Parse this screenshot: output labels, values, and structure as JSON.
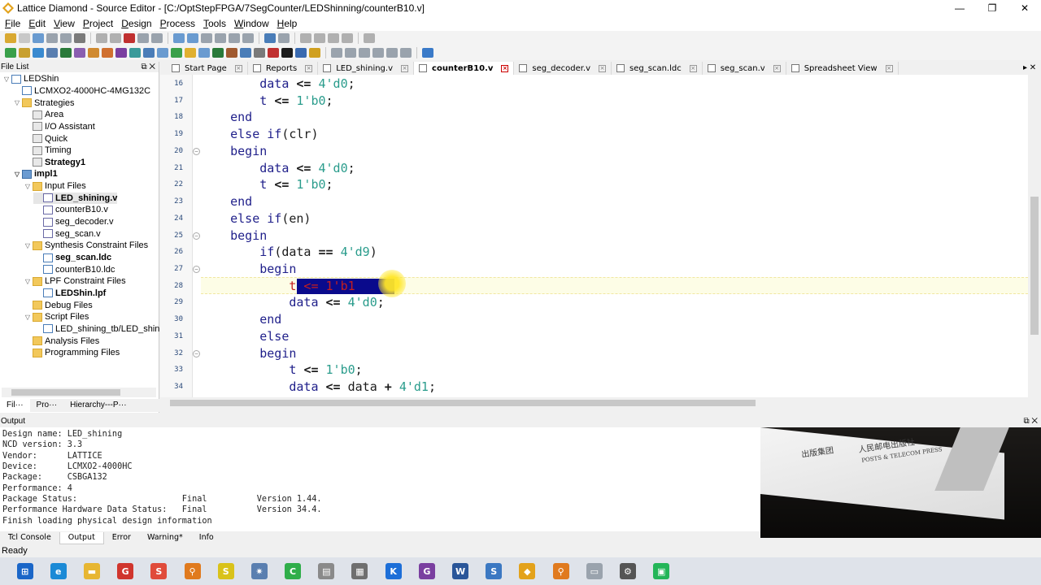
{
  "window": {
    "title": "Lattice Diamond - Source Editor - [C:/OptStepFPGA/7SegCounter/LEDShinning/counterB10.v]",
    "controls": [
      "—",
      "❐",
      "✕"
    ]
  },
  "menu": [
    {
      "label": "File",
      "key": "F"
    },
    {
      "label": "Edit",
      "key": "E"
    },
    {
      "label": "View",
      "key": "V"
    },
    {
      "label": "Project",
      "key": "P"
    },
    {
      "label": "Design",
      "key": "D"
    },
    {
      "label": "Process",
      "key": "P"
    },
    {
      "label": "Tools",
      "key": "T"
    },
    {
      "label": "Window",
      "key": "W"
    },
    {
      "label": "Help",
      "key": "H"
    }
  ],
  "file_list": {
    "title": "File List",
    "controls": "⧉ ✕",
    "items": [
      {
        "label": "LEDShin",
        "level": 0,
        "tw": "▽",
        "icon": "chip"
      },
      {
        "label": "LCMXO2-4000HC-4MG132C",
        "level": 1,
        "tw": "",
        "icon": "chip"
      },
      {
        "label": "Strategies",
        "level": 1,
        "tw": "▽",
        "icon": "folder"
      },
      {
        "label": "Area",
        "level": 2,
        "tw": "",
        "icon": "strat"
      },
      {
        "label": "I/O Assistant",
        "level": 2,
        "tw": "",
        "icon": "strat"
      },
      {
        "label": "Quick",
        "level": 2,
        "tw": "",
        "icon": "strat"
      },
      {
        "label": "Timing",
        "level": 2,
        "tw": "",
        "icon": "strat"
      },
      {
        "label": "Strategy1",
        "level": 2,
        "tw": "",
        "icon": "strat",
        "bold": true
      },
      {
        "label": "impl1",
        "level": 1,
        "tw": "▽",
        "icon": "impl",
        "bold": true
      },
      {
        "label": "Input Files",
        "level": 2,
        "tw": "▽",
        "icon": "folder"
      },
      {
        "label": "LED_shining.v",
        "level": 3,
        "tw": "",
        "icon": "vfile",
        "bold": true,
        "sel": true
      },
      {
        "label": "counterB10.v",
        "level": 3,
        "tw": "",
        "icon": "vfile"
      },
      {
        "label": "seg_decoder.v",
        "level": 3,
        "tw": "",
        "icon": "vfile"
      },
      {
        "label": "seg_scan.v",
        "level": 3,
        "tw": "",
        "icon": "vfile"
      },
      {
        "label": "Synthesis Constraint Files",
        "level": 2,
        "tw": "▽",
        "icon": "folder"
      },
      {
        "label": "seg_scan.ldc",
        "level": 3,
        "tw": "",
        "icon": "ldc",
        "bold": true
      },
      {
        "label": "counterB10.ldc",
        "level": 3,
        "tw": "",
        "icon": "ldc"
      },
      {
        "label": "LPF Constraint Files",
        "level": 2,
        "tw": "▽",
        "icon": "folder"
      },
      {
        "label": "LEDShin.lpf",
        "level": 3,
        "tw": "",
        "icon": "ldc",
        "bold": true
      },
      {
        "label": "Debug Files",
        "level": 2,
        "tw": "",
        "icon": "folder"
      },
      {
        "label": "Script Files",
        "level": 2,
        "tw": "▽",
        "icon": "folder"
      },
      {
        "label": "LED_shining_tb/LED_shini",
        "level": 3,
        "tw": "",
        "icon": "ldc"
      },
      {
        "label": "Analysis Files",
        "level": 2,
        "tw": "",
        "icon": "folder"
      },
      {
        "label": "Programming Files",
        "level": 2,
        "tw": "",
        "icon": "folder"
      }
    ],
    "bottom_tabs": [
      "Fil···",
      "Pro···",
      "Hierarchy---P···"
    ]
  },
  "editor_tabs": [
    {
      "label": "Start Page",
      "active": false
    },
    {
      "label": "Reports",
      "active": false
    },
    {
      "label": "LED_shining.v",
      "active": false
    },
    {
      "label": "counterB10.v",
      "active": true
    },
    {
      "label": "seg_decoder.v",
      "active": false
    },
    {
      "label": "seg_scan.ldc",
      "active": false
    },
    {
      "label": "seg_scan.v",
      "active": false
    },
    {
      "label": "Spreadsheet View",
      "active": false
    }
  ],
  "editor_corner": "▸ ✕",
  "code": [
    {
      "ln": "16",
      "fold": "",
      "tokens": [
        [
          "        ",
          ""
        ],
        [
          "data",
          "kw"
        ],
        [
          " ",
          ""
        ],
        [
          "<=",
          "op"
        ],
        [
          " ",
          ""
        ],
        [
          "4'd0",
          "num"
        ],
        [
          ";",
          ""
        ]
      ]
    },
    {
      "ln": "17",
      "fold": "",
      "tokens": [
        [
          "        ",
          ""
        ],
        [
          "t",
          "kw"
        ],
        [
          " ",
          ""
        ],
        [
          "<=",
          "op"
        ],
        [
          " ",
          ""
        ],
        [
          "1'b0",
          "num"
        ],
        [
          ";",
          ""
        ]
      ]
    },
    {
      "ln": "18",
      "fold": "",
      "tokens": [
        [
          "    ",
          ""
        ],
        [
          "end",
          "kw"
        ]
      ]
    },
    {
      "ln": "19",
      "fold": "",
      "tokens": [
        [
          "    ",
          ""
        ],
        [
          "else if",
          "kw"
        ],
        [
          "(clr)",
          ""
        ]
      ]
    },
    {
      "ln": "20",
      "fold": "⊖",
      "tokens": [
        [
          "    ",
          ""
        ],
        [
          "begin",
          "kw"
        ]
      ]
    },
    {
      "ln": "21",
      "fold": "",
      "tokens": [
        [
          "        ",
          ""
        ],
        [
          "data",
          "kw"
        ],
        [
          " ",
          ""
        ],
        [
          "<=",
          "op"
        ],
        [
          " ",
          ""
        ],
        [
          "4'd0",
          "num"
        ],
        [
          ";",
          ""
        ]
      ]
    },
    {
      "ln": "22",
      "fold": "",
      "tokens": [
        [
          "        ",
          ""
        ],
        [
          "t",
          "kw"
        ],
        [
          " ",
          ""
        ],
        [
          "<=",
          "op"
        ],
        [
          " ",
          ""
        ],
        [
          "1'b0",
          "num"
        ],
        [
          ";",
          ""
        ]
      ]
    },
    {
      "ln": "23",
      "fold": "",
      "tokens": [
        [
          "    ",
          ""
        ],
        [
          "end",
          "kw"
        ]
      ]
    },
    {
      "ln": "24",
      "fold": "",
      "tokens": [
        [
          "    ",
          ""
        ],
        [
          "else if",
          "kw"
        ],
        [
          "(en)",
          ""
        ]
      ]
    },
    {
      "ln": "25",
      "fold": "⊖",
      "tokens": [
        [
          "    ",
          ""
        ],
        [
          "begin",
          "kw"
        ]
      ]
    },
    {
      "ln": "26",
      "fold": "",
      "tokens": [
        [
          "        ",
          ""
        ],
        [
          "if",
          "kw"
        ],
        [
          "(data ",
          ""
        ],
        [
          "==",
          "op"
        ],
        [
          " ",
          ""
        ],
        [
          "4'd9",
          "num"
        ],
        [
          ")",
          ""
        ]
      ]
    },
    {
      "ln": "27",
      "fold": "⊖",
      "tokens": [
        [
          "        ",
          ""
        ],
        [
          "begin",
          "kw"
        ]
      ]
    },
    {
      "ln": "28",
      "fold": "",
      "tokens": [
        [
          "            ",
          ""
        ],
        [
          "t <= 1'b1",
          "sel"
        ]
      ]
    },
    {
      "ln": "29",
      "fold": "",
      "tokens": [
        [
          "            ",
          ""
        ],
        [
          "data",
          "kw"
        ],
        [
          " ",
          ""
        ],
        [
          "<=",
          "op"
        ],
        [
          " ",
          ""
        ],
        [
          "4'd0",
          "num"
        ],
        [
          ";",
          ""
        ]
      ]
    },
    {
      "ln": "30",
      "fold": "",
      "tokens": [
        [
          "        ",
          ""
        ],
        [
          "end",
          "kw"
        ]
      ]
    },
    {
      "ln": "31",
      "fold": "",
      "tokens": [
        [
          "        ",
          ""
        ],
        [
          "else",
          "kw"
        ]
      ]
    },
    {
      "ln": "32",
      "fold": "⊖",
      "tokens": [
        [
          "        ",
          ""
        ],
        [
          "begin",
          "kw"
        ]
      ]
    },
    {
      "ln": "33",
      "fold": "",
      "tokens": [
        [
          "            ",
          ""
        ],
        [
          "t",
          "kw"
        ],
        [
          " ",
          ""
        ],
        [
          "<=",
          "op"
        ],
        [
          " ",
          ""
        ],
        [
          "1'b0",
          "num"
        ],
        [
          ";",
          ""
        ]
      ]
    },
    {
      "ln": "34",
      "fold": "",
      "tokens": [
        [
          "            ",
          ""
        ],
        [
          "data",
          "kw"
        ],
        [
          " ",
          ""
        ],
        [
          "<=",
          "op"
        ],
        [
          " data ",
          ""
        ],
        [
          "+",
          "op"
        ],
        [
          " ",
          ""
        ],
        [
          "4'd1",
          "num"
        ],
        [
          ";",
          ""
        ]
      ]
    }
  ],
  "output": {
    "title": "Output",
    "controls": "⧉ ✕",
    "lines": [
      "Design name: LED_shining",
      "NCD version: 3.3",
      "Vendor:      LATTICE",
      "Device:      LCMXO2-4000HC",
      "Package:     CSBGA132",
      "Performance: 4",
      "Package Status:                     Final          Version 1.44.",
      "Performance Hardware Data Status:   Final          Version 34.4.",
      "Finish loading physical design information"
    ],
    "tabs": [
      {
        "label": "Tcl Console",
        "active": false
      },
      {
        "label": "Output",
        "active": true
      },
      {
        "label": "Error",
        "active": false
      },
      {
        "label": "Warning*",
        "active": false
      },
      {
        "label": "Info",
        "active": false
      }
    ]
  },
  "photo_text": [
    "出版集团",
    "人民邮电出版社",
    "POSTS & TELECOM PRESS"
  ],
  "status": "Ready",
  "taskbar": [
    {
      "name": "start-icon",
      "color": "#1a66c8",
      "glyph": "⊞"
    },
    {
      "name": "edge-icon",
      "color": "#1b8ad6",
      "glyph": "e"
    },
    {
      "name": "file-explorer-icon",
      "color": "#e7b632",
      "glyph": "▬"
    },
    {
      "name": "app-red-g-icon",
      "color": "#d0352d",
      "glyph": "G"
    },
    {
      "name": "app-red-s-icon",
      "color": "#e04b3a",
      "glyph": "S"
    },
    {
      "name": "search-tool-icon",
      "color": "#e07a1e",
      "glyph": "⚲"
    },
    {
      "name": "app-yellow-icon",
      "color": "#d9c21a",
      "glyph": "S"
    },
    {
      "name": "gear-blue-icon",
      "color": "#5a7fb0",
      "glyph": "✷"
    },
    {
      "name": "app-green-icon",
      "color": "#2fae4a",
      "glyph": "C"
    },
    {
      "name": "notepad-icon",
      "color": "#8a8a8a",
      "glyph": "▤"
    },
    {
      "name": "calculator-icon",
      "color": "#6f6f6f",
      "glyph": "▦"
    },
    {
      "name": "app-blue-k-icon",
      "color": "#1d6fd8",
      "glyph": "K"
    },
    {
      "name": "app-purple-icon",
      "color": "#7a3fa0",
      "glyph": "G"
    },
    {
      "name": "word-icon",
      "color": "#2a5699",
      "glyph": "W"
    },
    {
      "name": "app-s-blue-icon",
      "color": "#3b78c2",
      "glyph": "S"
    },
    {
      "name": "diamond-icon",
      "color": "#e3a21b",
      "glyph": "◆"
    },
    {
      "name": "search-orange-icon",
      "color": "#e07a1e",
      "glyph": "⚲"
    },
    {
      "name": "window-icon",
      "color": "#9aa3ad",
      "glyph": "▭"
    },
    {
      "name": "settings-icon",
      "color": "#555",
      "glyph": "⚙"
    },
    {
      "name": "app-green-box-icon",
      "color": "#23b558",
      "glyph": "▣"
    }
  ],
  "colors": {
    "keyword": "#1f1f8a",
    "number": "#2a9c8c",
    "selection": "#0a0a8c",
    "selection_text": "#c41f1f",
    "current_line": "#fdfde6"
  }
}
